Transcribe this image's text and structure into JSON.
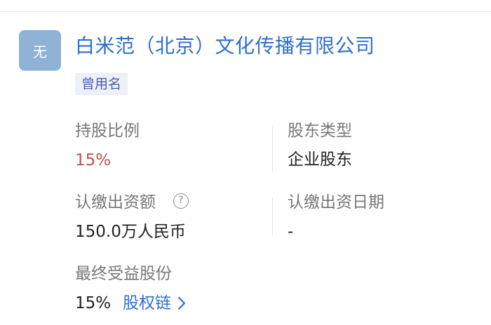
{
  "company": {
    "avatar_text": "无",
    "name": "白米范（北京）文化传播有限公司",
    "former_name_tag": "曾用名"
  },
  "fields": {
    "shareholding_ratio": {
      "label": "持股比例",
      "value": "15%"
    },
    "shareholder_type": {
      "label": "股东类型",
      "value": "企业股东"
    },
    "subscribed_capital": {
      "label": "认缴出资额",
      "value": "150.0万人民币",
      "help_icon": "?"
    },
    "subscription_date": {
      "label": "认缴出资日期",
      "value": "-"
    },
    "beneficial_ownership": {
      "label": "最终受益股份",
      "value": "15%",
      "link": "股权链"
    }
  },
  "colors": {
    "accent": "#2f6fcf",
    "ratio_red": "#c0524b",
    "avatar_bg": "#8fb2d6",
    "tag_bg": "#eef0f7"
  },
  "icons": {
    "help": "question-circle-icon",
    "link_arrow": "chevron-right-icon"
  }
}
